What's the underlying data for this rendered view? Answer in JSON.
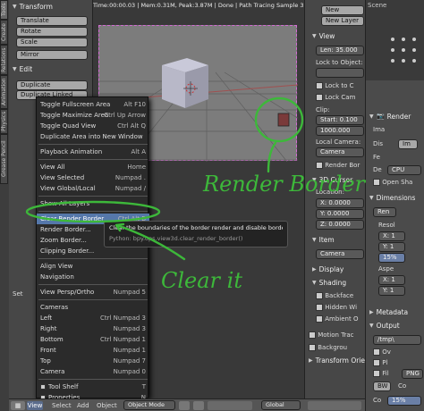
{
  "status_bar": {
    "text": "Time:00:00.03 | Mem:0.31M, Peak:3.87M | Done | Path Tracing Sample 32/32"
  },
  "tool_tabs": [
    "Tools",
    "Create",
    "Relations",
    "Animation",
    "Physics",
    "Grease Pencil"
  ],
  "tool_shelf": {
    "transform_header": "Transform",
    "translate": "Translate",
    "rotate": "Rotate",
    "scale": "Scale",
    "mirror": "Mirror",
    "edit_header": "Edit",
    "duplicate": "Duplicate",
    "duplicate_linked": "Duplicate Linked",
    "set_label": "Set"
  },
  "view_menu": {
    "items": [
      {
        "label": "Toggle Fullscreen Area",
        "shortcut": "Alt F10"
      },
      {
        "label": "Toggle Maximize Area",
        "shortcut": "Ctrl Up Arrow"
      },
      {
        "label": "Toggle Quad View",
        "shortcut": "Ctrl Alt Q"
      },
      {
        "label": "Duplicate Area into New Window",
        "shortcut": ""
      },
      {
        "label": "Playback Animation",
        "shortcut": "Alt A"
      },
      {
        "label": "View All",
        "shortcut": "Home"
      },
      {
        "label": "View Selected",
        "shortcut": "Numpad ."
      },
      {
        "label": "View Global/Local",
        "shortcut": "Numpad /"
      },
      {
        "label": "Show All Layers",
        "shortcut": ""
      },
      {
        "label": "Clear Render Border",
        "shortcut": "Ctrl Alt B"
      },
      {
        "label": "Render Border...",
        "shortcut": "Shift B"
      },
      {
        "label": "Zoom Border...",
        "shortcut": ""
      },
      {
        "label": "Clipping Border...",
        "shortcut": ""
      },
      {
        "label": "Align View",
        "shortcut": ""
      },
      {
        "label": "Navigation",
        "shortcut": ""
      },
      {
        "label": "View Persp/Ortho",
        "shortcut": "Numpad 5"
      },
      {
        "label": "Cameras",
        "shortcut": ""
      },
      {
        "label": "Left",
        "shortcut": "Ctrl Numpad 3"
      },
      {
        "label": "Right",
        "shortcut": "Numpad 3"
      },
      {
        "label": "Bottom",
        "shortcut": "Ctrl Numpad 1"
      },
      {
        "label": "Front",
        "shortcut": "Numpad 1"
      },
      {
        "label": "Top",
        "shortcut": "Numpad 7"
      },
      {
        "label": "Camera",
        "shortcut": "Numpad 0"
      },
      {
        "label": "Tool Shelf",
        "shortcut": "T"
      },
      {
        "label": "Properties",
        "shortcut": "N"
      }
    ]
  },
  "tooltip": {
    "text": "Clear the boundaries of the border render and disable border render.",
    "python": "Python: bpy.ops.view3d.clear_render_border()"
  },
  "annotations": {
    "render_border": "Render Border",
    "clear_it": "Clear it"
  },
  "bottom_bar": {
    "view": "View",
    "select": "Select",
    "add": "Add",
    "object": "Object",
    "mode": "Object Mode",
    "pivot": "Global"
  },
  "properties_panel": {
    "new_label": "New",
    "new_layer": "New Layer",
    "view_header": "View",
    "lens": "Len: 35.000",
    "lock_to_object": "Lock to Object:",
    "lock_to_cursor": "Lock to C",
    "lock_camera": "Lock Cam",
    "clip_header": "Clip:",
    "clip_start": "Start: 0.100",
    "clip_end": "1000.000",
    "local_camera": "Local Camera:",
    "camera_field": "Camera",
    "render_border": "Render Bor",
    "cursor_header": "3D Cursor",
    "location_header": "Location:",
    "cursor_x": "X: 0.0000",
    "cursor_y": "Y: 0.0000",
    "cursor_z": "Z: 0.0000",
    "item_header": "Item",
    "item_camera": "Camera",
    "display_header": "Display",
    "shading_header": "Shading",
    "backface": "Backface",
    "hidden_wire": "Hidden Wi",
    "ambient_occlusion": "Ambient O",
    "motion_tracking": "Motion Trac",
    "background": "Backgrou",
    "transform_orientation": "Transform Orie"
  },
  "render_panel": {
    "header": "Render",
    "ima_label": "Ima",
    "dis_label": "Dis",
    "im_label": "Im",
    "fe_label": "Fe",
    "device_label": "De",
    "device_value": "CPU",
    "open_shading": "Open Sha",
    "dimensions_header": "Dimensions",
    "ren_label": "Ren",
    "resolution_label": "Resol",
    "res_x": "X: 1",
    "res_y": "Y: 1",
    "res_pct": "15%",
    "aspect_label": "Aspe",
    "asp_x": "X: 1",
    "asp_y": "Y: 1",
    "metadata_header": "Metadata",
    "output_header": "Output",
    "output_path": "/tmp\\",
    "overwrite": "Ov",
    "placeholders": "Pl",
    "file_ext": "Fil",
    "png_label": "PNG",
    "bw_label": "BW",
    "color_depth": "Co",
    "compression_label": "Co",
    "compression_value": "15%"
  },
  "outliner": {
    "scene_label": "Scene"
  }
}
